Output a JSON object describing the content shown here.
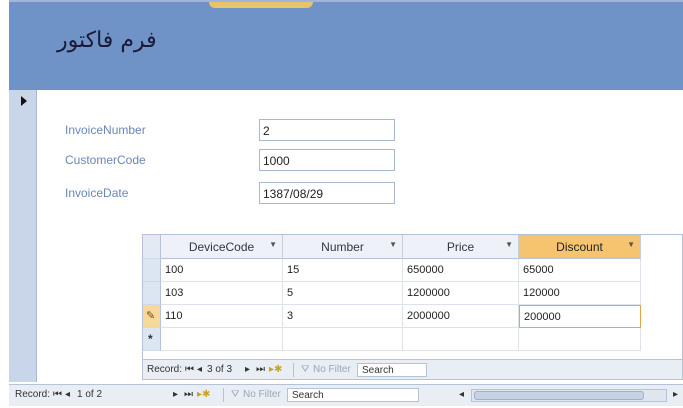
{
  "form": {
    "title": "فرم فاکتور"
  },
  "fields": [
    {
      "label": "InvoiceNumber",
      "value": "2"
    },
    {
      "label": "CustomerCode",
      "value": "1000"
    },
    {
      "label": "InvoiceDate",
      "value": "1387/08/29"
    }
  ],
  "subform": {
    "columns": [
      "DeviceCode",
      "Number",
      "Price",
      "Discount"
    ],
    "rows": [
      [
        "100",
        "15",
        "650000",
        "65000"
      ],
      [
        "103",
        "5",
        "1200000",
        "120000"
      ],
      [
        "110",
        "3",
        "2000000",
        "200000"
      ]
    ],
    "new_row_marker": "*",
    "edit_marker": "✎",
    "nav": {
      "label": "Record:",
      "position": "3 of 3",
      "filter": "No Filter",
      "search": "Search"
    }
  },
  "main_nav": {
    "label": "Record:",
    "position": "1 of 2",
    "filter": "No Filter",
    "search": "Search"
  }
}
